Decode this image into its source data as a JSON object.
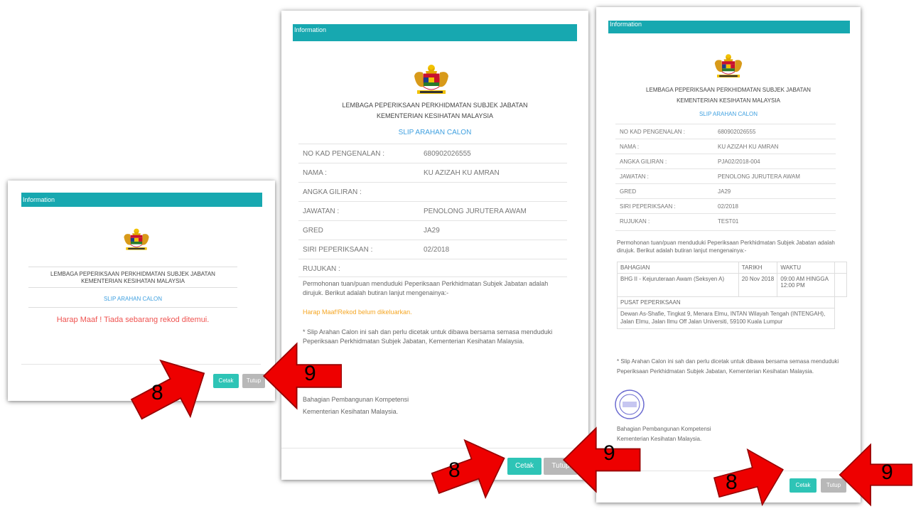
{
  "common": {
    "header": "Information",
    "org_line1": "LEMBAGA PEPERIKSAAN PERKHIDMATAN SUBJEK JABATAN",
    "org_line2": "KEMENTERIAN KESIHATAN MALAYSIA",
    "slip": "SLIP ARAHAN CALON",
    "cetak": "Cetak",
    "tutup": "Tutup"
  },
  "panel1": {
    "error": "Harap Maaf ! Tiada sebarang rekod ditemui."
  },
  "panel2": {
    "rows": [
      {
        "label": "NO KAD PENGENALAN :",
        "value": "680902026555"
      },
      {
        "label": "NAMA :",
        "value": "KU AZIZAH KU AMRAN"
      },
      {
        "label": "ANGKA GILIRAN :",
        "value": ""
      },
      {
        "label": "JAWATAN :",
        "value": "PENOLONG JURUTERA AWAM"
      },
      {
        "label": "GRED",
        "value": "JA29"
      },
      {
        "label": "SIRI PEPERIKSAAN :",
        "value": "02/2018"
      },
      {
        "label": "RUJUKAN :",
        "value": ""
      }
    ],
    "intro": "Permohonan tuan/puan menduduki Peperiksaan Perkhidmatan Subjek Jabatan adalah dirujuk. Berikut adalah butiran lanjut mengenainya:-",
    "warning": "Harap Maaf!Rekod belum dikeluarkan.",
    "note": "* Slip Arahan Calon ini sah dan perlu dicetak untuk dibawa bersama semasa menduduki Peperiksaan Perkhidmatan Subjek Jabatan, Kementerian Kesihatan Malaysia.",
    "sign1": "Bahagian Pembangunan Kompetensi",
    "sign2": "Kementerian Kesihatan Malaysia."
  },
  "panel3": {
    "rows": [
      {
        "label": "NO KAD PENGENALAN :",
        "value": "680902026555"
      },
      {
        "label": "NAMA :",
        "value": "KU AZIZAH KU AMRAN"
      },
      {
        "label": "ANGKA GILIRAN :",
        "value": "PJA02/2018-004"
      },
      {
        "label": "JAWATAN :",
        "value": "PENOLONG JURUTERA AWAM"
      },
      {
        "label": "GRED",
        "value": "JA29"
      },
      {
        "label": "SIRI PEPERIKSAAN :",
        "value": "02/2018"
      },
      {
        "label": "RUJUKAN :",
        "value": "TEST01"
      }
    ],
    "intro": "Permohonan tuan/puan menduduki Peperiksaan Perkhidmatan Subjek Jabatan adalah dirujuk. Berikut adalah butiran lanjut mengenainya:-",
    "table": {
      "h_bahagian": "BAHAGIAN",
      "h_tarikh": "TARIKH",
      "h_waktu": "WAKTU",
      "bahagian": "BHG II - Kejuruteraan Awam (Seksyen A)",
      "tarikh": "20 Nov 2018",
      "waktu": "09:00 AM HINGGA 12:00 PM",
      "h_pusat": "PUSAT PEPERIKSAAN",
      "pusat": "Dewan As-Shafie, Tingkat 9, Menara Elmu, INTAN Wilayah Tengah (INTENGAH), Jalan Elmu, Jalan Ilmu Off Jalan Universiti, 59100 Kuala Lumpur"
    },
    "note": "* Slip Arahan Calon ini sah dan perlu dicetak untuk dibawa bersama semasa menduduki Peperiksaan Perkhidmatan Subjek Jabatan, Kementerian Kesihatan Malaysia.",
    "sign1": "Bahagian Pembangunan Kompetensi",
    "sign2": "Kementerian Kesihatan Malaysia."
  },
  "callouts": {
    "eight": "8",
    "nine": "9"
  },
  "colors": {
    "header": "#17a8b0",
    "slip": "#3fa0e0",
    "error": "#ef5350",
    "warning": "#f5a623",
    "cetak": "#2ec4b6",
    "tutup": "#b8b8b8",
    "arrow": "#ee0000"
  }
}
